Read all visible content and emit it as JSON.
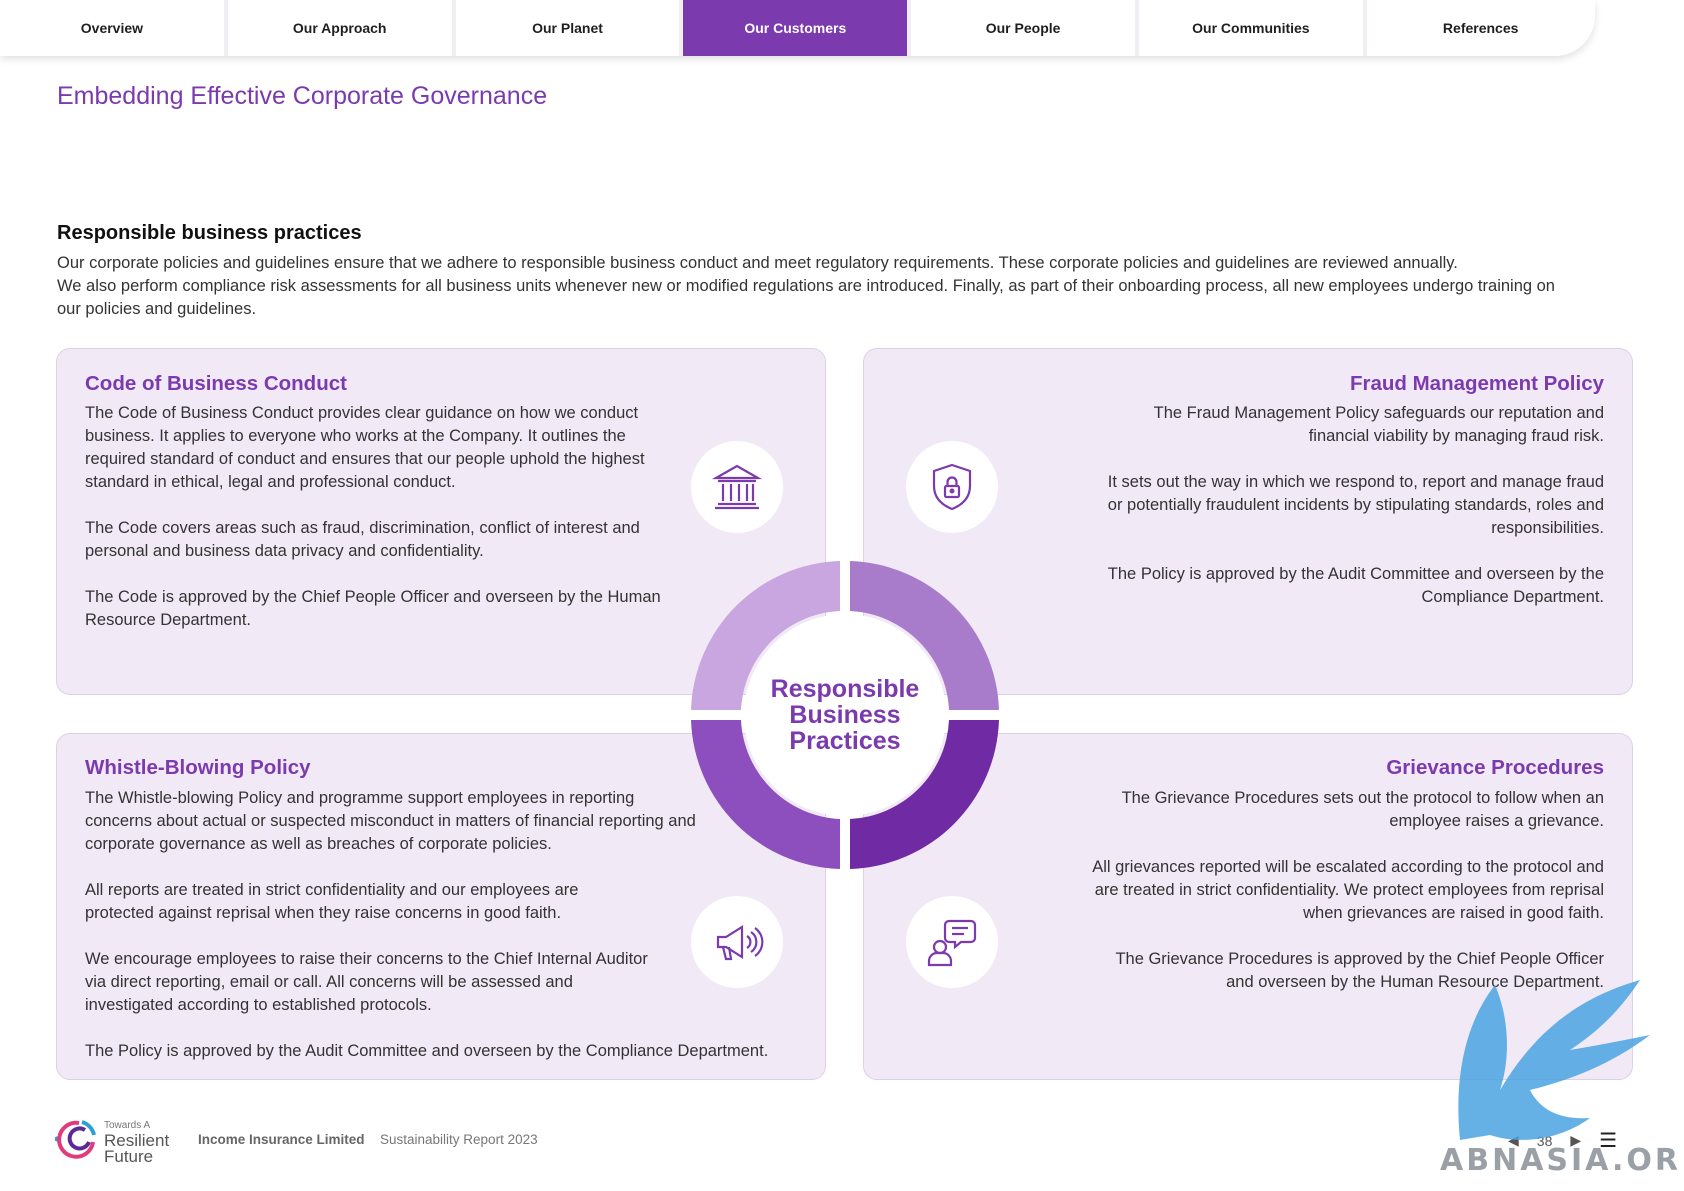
{
  "nav": {
    "tabs": [
      {
        "label": "Overview"
      },
      {
        "label": "Our Approach"
      },
      {
        "label": "Our Planet"
      },
      {
        "label": "Our Customers",
        "active": true
      },
      {
        "label": "Our People"
      },
      {
        "label": "Our Communities"
      },
      {
        "label": "References"
      }
    ]
  },
  "page": {
    "title": "Embedding Effective Corporate Governance",
    "section_heading": "Responsible business practices",
    "intro": [
      "Our corporate policies and guidelines ensure that we adhere to responsible business conduct and meet regulatory requirements. These corporate policies and guidelines are reviewed annually.",
      "We also perform compliance risk assessments for all business units whenever new or modified regulations are introduced. Finally, as part of their onboarding process, all new employees undergo training on our policies and guidelines."
    ]
  },
  "cards": {
    "code": {
      "heading": "Code of Business Conduct",
      "icon": "bank-building-icon",
      "paragraphs": [
        "The Code of Business Conduct provides clear guidance on how we conduct business. It applies to everyone who works at the Company. It outlines the required standard of conduct and ensures that our people uphold the highest standard in ethical, legal and professional conduct.",
        "The Code covers areas such as fraud, discrimination, conflict of interest and personal and business data privacy and confidentiality.",
        "The Code is approved by the Chief People Officer and overseen by the Human Resource Department."
      ]
    },
    "fraud": {
      "heading": "Fraud Management Policy",
      "icon": "shield-lock-icon",
      "paragraphs": [
        "The Fraud Management Policy safeguards our reputation and financial viability by managing fraud risk.",
        "It sets out the way in which we respond to, report and manage fraud or potentially fraudulent incidents by stipulating standards, roles and responsibilities.",
        "The Policy is approved by the Audit Committee and overseen by the Compliance Department."
      ]
    },
    "whistle": {
      "heading": "Whistle-Blowing Policy",
      "icon": "megaphone-icon",
      "paragraphs": [
        "The Whistle-blowing Policy and programme support employees in reporting concerns about actual or suspected misconduct in matters of financial reporting and corporate governance as well as breaches of corporate policies.",
        "All reports are treated in strict confidentiality and our employees are protected against reprisal when they raise concerns in good faith.",
        "We encourage employees to raise their concerns to the Chief Internal Auditor via direct reporting, email or call. All concerns will be assessed and investigated according to established protocols.",
        "The Policy is approved by the Audit Committee and overseen by the Compliance Department."
      ]
    },
    "grievance": {
      "heading": "Grievance Procedures",
      "icon": "person-chat-icon",
      "paragraphs": [
        "The Grievance Procedures sets out the protocol to follow when an employee raises a grievance.",
        "All grievances reported will be escalated according to the protocol and are treated in strict confidentiality. We protect employees from reprisal when grievances are raised in good faith.",
        "The Grievance Procedures is approved by the Chief People Officer and overseen by the Human Resource Department."
      ]
    }
  },
  "center": {
    "lines": [
      "Responsible",
      "Business",
      "Practices"
    ],
    "quadrant_colors": [
      "#c9a6df",
      "#a87ccb",
      "#8e4fbe",
      "#6f2aa4"
    ]
  },
  "footer": {
    "logo_small": "Towards A",
    "logo_line1": "Resilient",
    "logo_line2": "Future",
    "company": "Income Insurance Limited",
    "report": "Sustainability Report 2023",
    "page_number": "38"
  },
  "watermark": {
    "text": "ABNASIA.ORG"
  },
  "colors": {
    "accent": "#7b3aad",
    "card_bg": "#f1e9f6"
  }
}
